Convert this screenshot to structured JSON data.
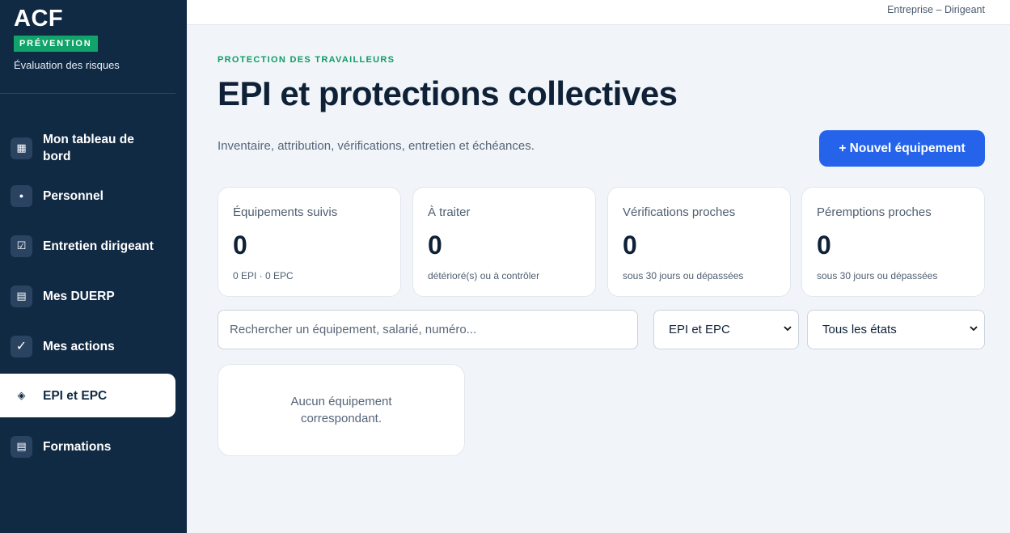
{
  "brand": {
    "name": "ACF",
    "badge": "PRÉVENTION",
    "subtitle": "Évaluation des risques"
  },
  "sidebar": {
    "items": [
      {
        "label": "Mon tableau de bord",
        "icon": "grid-icon",
        "glyph": "▦",
        "active": false
      },
      {
        "label": "Personnel",
        "icon": "dot-icon",
        "glyph": "●",
        "active": false
      },
      {
        "label": "Entretien dirigeant",
        "icon": "checkbox-icon",
        "glyph": "☑",
        "active": false
      },
      {
        "label": "Mes DUERP",
        "icon": "document-icon",
        "glyph": "▤",
        "active": false
      },
      {
        "label": "Mes actions",
        "icon": "checkmark-icon",
        "glyph": "✓",
        "active": false
      },
      {
        "label": "EPI et EPC",
        "icon": "diamond-icon",
        "glyph": "◈",
        "active": true
      },
      {
        "label": "Formations",
        "icon": "document-icon",
        "glyph": "▤",
        "active": false
      }
    ]
  },
  "topbar": {
    "user": "Entreprise – Dirigeant"
  },
  "header": {
    "eyebrow": "PROTECTION DES TRAVAILLEURS",
    "title": "EPI et protections collectives",
    "description": "Inventaire, attribution, vérifications, entretien et échéances.",
    "new_button": "+ Nouvel équipement"
  },
  "stats": [
    {
      "label": "Équipements suivis",
      "value": "0",
      "note": "0 EPI · 0 EPC"
    },
    {
      "label": "À traiter",
      "value": "0",
      "note": "détérioré(s) ou à contrôler"
    },
    {
      "label": "Vérifications proches",
      "value": "0",
      "note": "sous 30 jours ou dépassées"
    },
    {
      "label": "Péremptions proches",
      "value": "0",
      "note": "sous 30 jours ou dépassées"
    }
  ],
  "filters": {
    "search_placeholder": "Rechercher un équipement, salarié, numéro...",
    "type_select": "EPI et EPC",
    "state_select": "Tous les états"
  },
  "empty_state": "Aucun équipement correspondant.",
  "colors": {
    "sidebar": "#112a44",
    "accent": "#2563eb",
    "badge": "#10a36a"
  }
}
